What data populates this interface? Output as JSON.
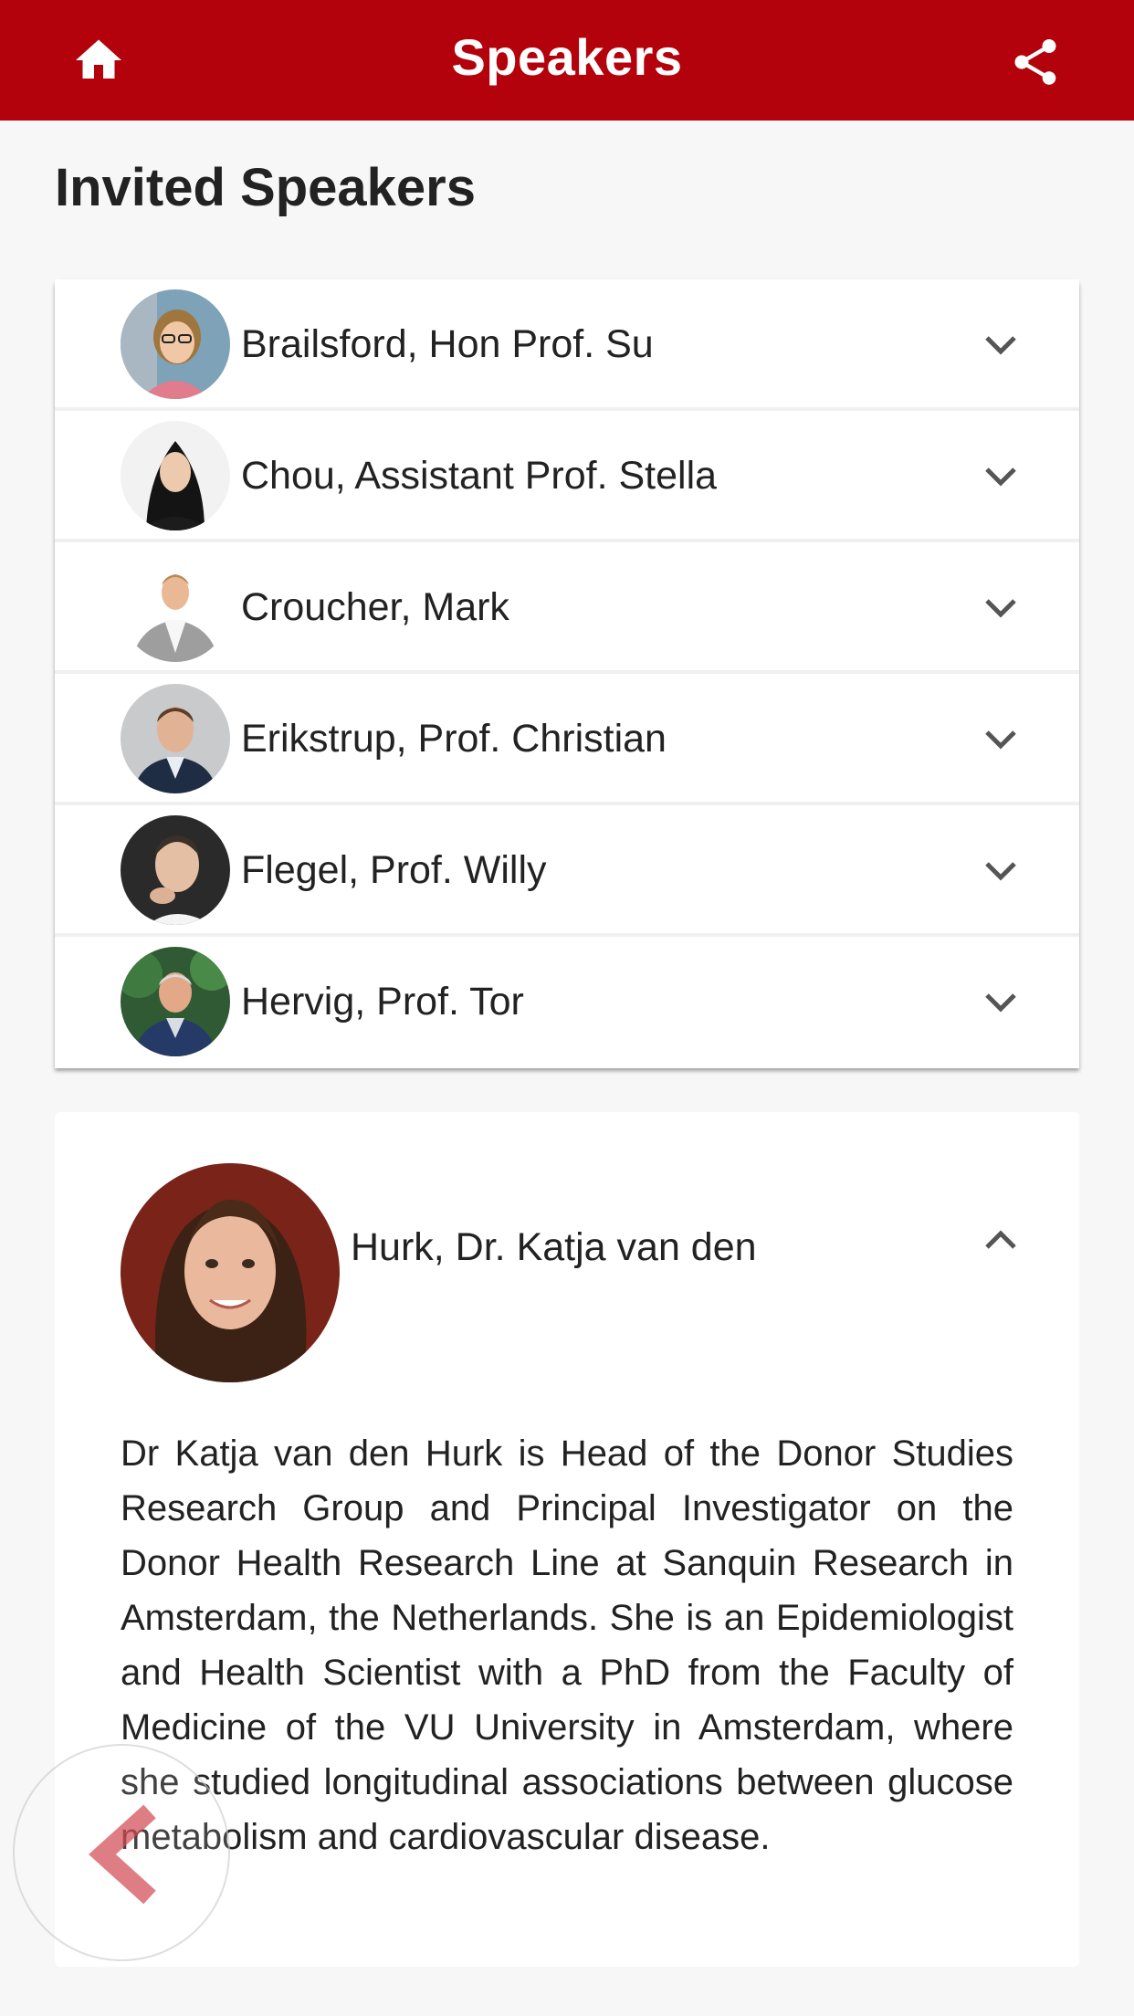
{
  "header": {
    "title": "Speakers",
    "home_icon": "home-icon",
    "share_icon": "share-icon",
    "background": "#b3020b"
  },
  "section_title": "Invited Speakers",
  "speakers": [
    {
      "name": "Brailsford, Hon Prof. Su",
      "expanded": false
    },
    {
      "name": "Chou, Assistant Prof. Stella",
      "expanded": false
    },
    {
      "name": "Croucher, Mark",
      "expanded": false
    },
    {
      "name": "Erikstrup, Prof. Christian",
      "expanded": false
    },
    {
      "name": "Flegel, Prof. Willy",
      "expanded": false
    },
    {
      "name": "Hervig, Prof. Tor",
      "expanded": false
    }
  ],
  "expanded_speaker": {
    "name": "Hurk, Dr. Katja van den",
    "expanded": true,
    "bio": "Dr Katja van den Hurk is Head of the Donor Studies Research Group and Principal Investigator on the Donor Health Research Line at Sanquin Research in Amsterdam, the Netherlands. She is an Epidemiologist and Health Scientist with a PhD from the Faculty of Medicine of the VU University in Amsterdam, where she studied longitudinal associations between glucose metabolism and cardiovascular disease."
  },
  "back_button_icon": "chevron-left-icon"
}
